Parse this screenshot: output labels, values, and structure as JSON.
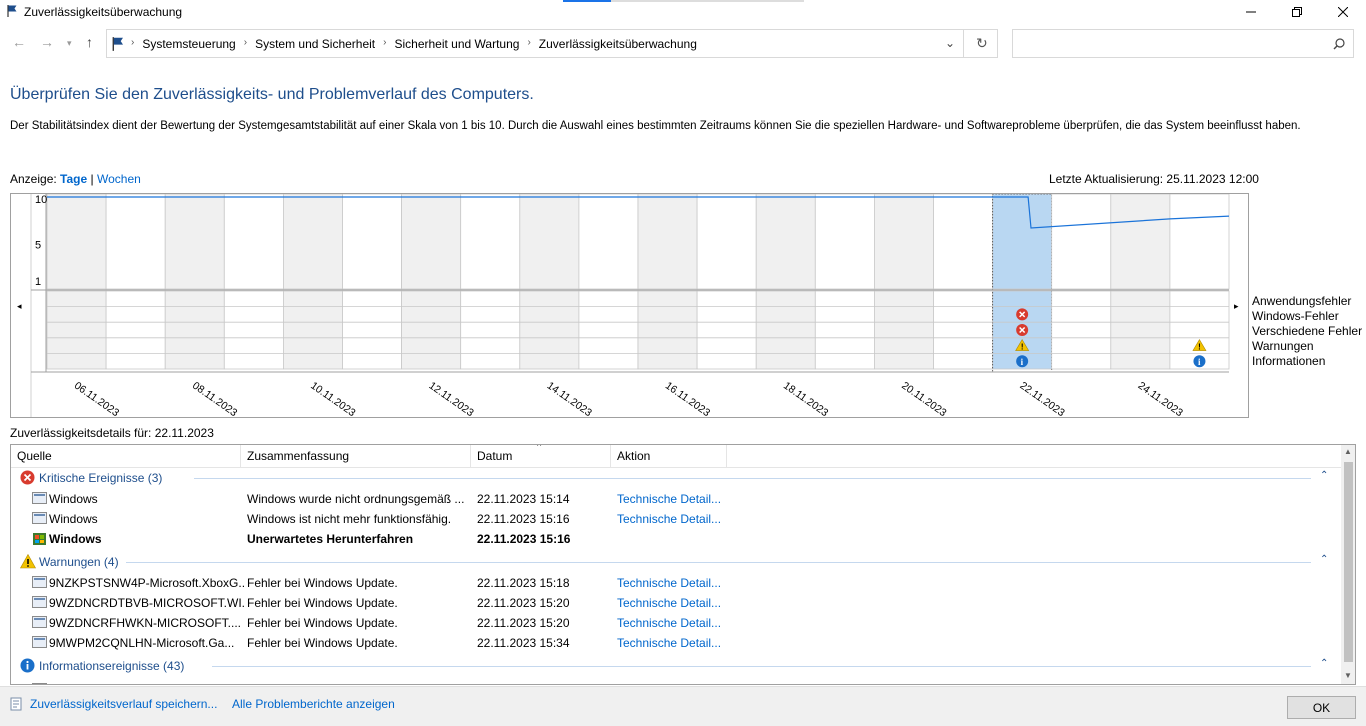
{
  "window": {
    "title": "Zuverlässigkeitsüberwachung"
  },
  "nav": {
    "breadcrumbs": [
      "Systemsteuerung",
      "System und Sicherheit",
      "Sicherheit und Wartung",
      "Zuverlässigkeitsüberwachung"
    ],
    "search_placeholder": ""
  },
  "header": {
    "heading": "Überprüfen Sie den Zuverlässigkeits- und Problemverlauf des Computers.",
    "intro": "Der Stabilitätsindex dient der Bewertung der Systemgesamtstabilität auf einer Skala von 1 bis 10. Durch die Auswahl eines bestimmten Zeitraums können Sie die speziellen Hardware- und Softwareprobleme überprüfen, die das System beeinflusst haben."
  },
  "view": {
    "label": "Anzeige:",
    "days": "Tage",
    "sep": "|",
    "weeks": "Wochen"
  },
  "last_update": "Letzte Aktualisierung: 25.11.2023 12:00",
  "chart_data": {
    "type": "line",
    "y_ticks": [
      "10",
      "5",
      "1"
    ],
    "ylim": [
      1,
      10
    ],
    "dates": [
      "06.11.2023",
      "08.11.2023",
      "10.11.2023",
      "12.11.2023",
      "14.11.2023",
      "16.11.2023",
      "18.11.2023",
      "20.11.2023",
      "22.11.2023",
      "24.11.2023"
    ],
    "stability_points": [
      {
        "col": 0,
        "y": 10
      },
      {
        "col": 16.6,
        "y": 10
      },
      {
        "col": 16.65,
        "y": 6.6
      },
      {
        "col": 19,
        "y": 7.6
      },
      {
        "col": 20,
        "y": 7.9
      }
    ],
    "columns": 20,
    "selected_column": 16,
    "event_rows": [
      "Anwendungsfehler",
      "Windows-Fehler",
      "Verschiedene Fehler",
      "Warnungen",
      "Informationen"
    ],
    "events": [
      {
        "col": 16,
        "row": 1,
        "kind": "error"
      },
      {
        "col": 16,
        "row": 2,
        "kind": "error"
      },
      {
        "col": 16,
        "row": 3,
        "kind": "warning"
      },
      {
        "col": 16,
        "row": 4,
        "kind": "info"
      },
      {
        "col": 19,
        "row": 3,
        "kind": "warning"
      },
      {
        "col": 19,
        "row": 4,
        "kind": "info"
      }
    ],
    "line_color": "#1a73d9",
    "selected_color": "#b9d7f2"
  },
  "details": {
    "label": "Zuverlässigkeitsdetails für: 22.11.2023",
    "columns": [
      "Quelle",
      "Zusammenfassung",
      "Datum",
      "Aktion"
    ],
    "groups": [
      {
        "title": "Kritische Ereignisse (3)",
        "icon": "error-icon",
        "rows": [
          {
            "source": "Windows",
            "summary": "Windows wurde nicht ordnungsgemäß ...",
            "date": "22.11.2023 15:14",
            "action": "Technische Detail...",
            "bold": false,
            "icon": "window-icon"
          },
          {
            "source": "Windows",
            "summary": "Windows ist nicht mehr funktionsfähig.",
            "date": "22.11.2023 15:16",
            "action": "Technische Detail...",
            "bold": false,
            "icon": "window-icon"
          },
          {
            "source": "Windows",
            "summary": "Unerwartetes Herunterfahren",
            "date": "22.11.2023 15:16",
            "action": "",
            "bold": true,
            "icon": "windows-shield-icon"
          }
        ]
      },
      {
        "title": "Warnungen (4)",
        "icon": "warning-icon",
        "rows": [
          {
            "source": "9NZKPSTSNW4P-Microsoft.XboxG...",
            "summary": "Fehler bei Windows Update.",
            "date": "22.11.2023 15:18",
            "action": "Technische Detail...",
            "bold": false,
            "icon": "window-icon"
          },
          {
            "source": "9WZDNCRDTBVB-MICROSOFT.WI...",
            "summary": "Fehler bei Windows Update.",
            "date": "22.11.2023 15:20",
            "action": "Technische Detail...",
            "bold": false,
            "icon": "window-icon"
          },
          {
            "source": "9WZDNCRFHWKN-MICROSOFT....",
            "summary": "Fehler bei Windows Update.",
            "date": "22.11.2023 15:20",
            "action": "Technische Detail...",
            "bold": false,
            "icon": "window-icon"
          },
          {
            "source": "9MWPM2CQNLHN-Microsoft.Ga...",
            "summary": "Fehler bei Windows Update.",
            "date": "22.11.2023 15:34",
            "action": "Technische Detail...",
            "bold": false,
            "icon": "window-icon"
          }
        ]
      },
      {
        "title": "Informationsereignisse (43)",
        "icon": "info-icon",
        "rows": []
      }
    ]
  },
  "footer": {
    "save_link": "Zuverlässigkeitsverlauf speichern...",
    "reports_link": "Alle Problemberichte anzeigen",
    "ok": "OK"
  },
  "colors": {
    "link": "#0066cc",
    "heading": "#1e4e8c",
    "error": "#d83b2e",
    "warning": "#f2c200",
    "info": "#1a6fc9"
  }
}
